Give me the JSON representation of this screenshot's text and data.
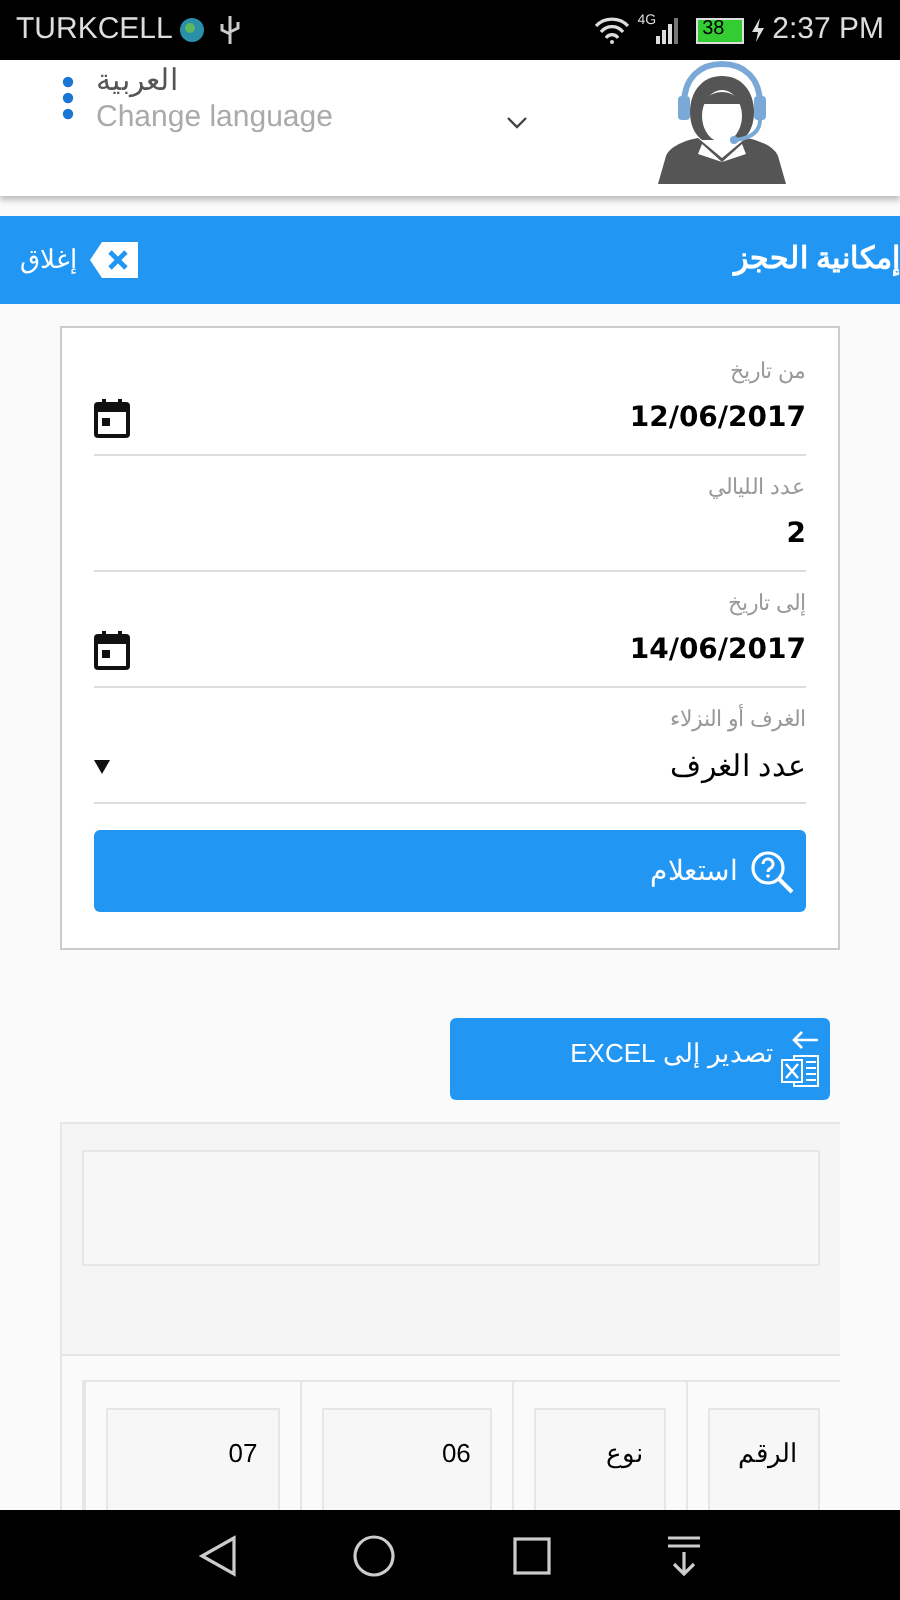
{
  "status_bar": {
    "carrier": "TURKCELL",
    "network": "4G",
    "battery": "38",
    "time": "2:37 PM"
  },
  "header": {
    "language": "العربية",
    "language_hint": "Change language"
  },
  "title_bar": {
    "title": "إمكانية الحجز",
    "close_label": "إغلاق"
  },
  "form": {
    "fields": [
      {
        "kind": "date",
        "label": "من تاريخ",
        "value": "12/06/2017"
      },
      {
        "kind": "number",
        "label": "عدد الليالي",
        "value": "2"
      },
      {
        "kind": "date",
        "label": "إلى تاريخ",
        "value": "14/06/2017"
      },
      {
        "kind": "select",
        "label": "الغرف أو النزلاء",
        "value": "عدد الغرف"
      }
    ],
    "submit": "استعلام"
  },
  "export_button": "تصدير إلى EXCEL",
  "table": {
    "columns": [
      "الرقم",
      "نوع",
      "06",
      "07"
    ]
  }
}
